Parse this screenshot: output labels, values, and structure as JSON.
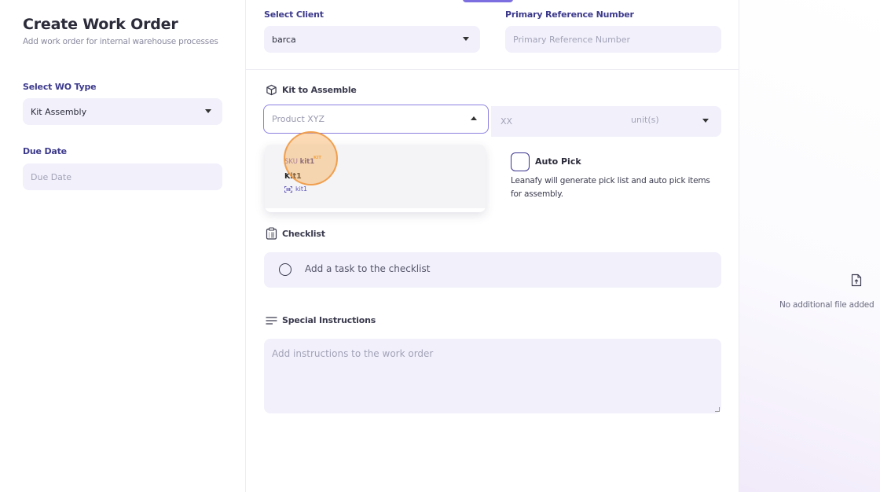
{
  "header": {
    "title": "Create Work Order",
    "subtitle": "Add work order for internal warehouse processes"
  },
  "left_form": {
    "wo_type_label": "Select WO Type",
    "wo_type_value": "Kit Assembly",
    "due_date_label": "Due Date",
    "due_date_placeholder": "Due Date"
  },
  "client": {
    "label": "Select Client",
    "value": "barca"
  },
  "reference": {
    "label": "Primary Reference Number",
    "placeholder": "Primary Reference Number"
  },
  "kit": {
    "section_title": "Kit to Assemble",
    "select_placeholder": "Product XYZ",
    "qty_placeholder": "XX",
    "unit_label": "unit(s)",
    "dropdown": {
      "sku_prefix": "SKU",
      "sku": "kit1",
      "tag": "KIT",
      "name": "Kit1",
      "barcode": "kit1"
    }
  },
  "auto_pick": {
    "label": "Auto Pick",
    "description": "Leanafy will generate pick list and auto pick items for assembly.",
    "checked": false
  },
  "checklist": {
    "section_title": "Checklist",
    "placeholder": "Add a task to the checklist"
  },
  "instructions": {
    "section_title": "Special Instructions",
    "placeholder": "Add instructions to the work order"
  },
  "files": {
    "empty_text": "No additional file added"
  },
  "colors": {
    "accent": "#7c6ee0",
    "label": "#3d3a8c",
    "field_bg": "#f1f0fb",
    "cursor_halo": "#f7ac5a"
  },
  "icons": [
    "box-icon",
    "clipboard-icon",
    "lines-icon",
    "caret-down-icon",
    "caret-up-icon",
    "barcode-icon",
    "file-upload-icon"
  ]
}
